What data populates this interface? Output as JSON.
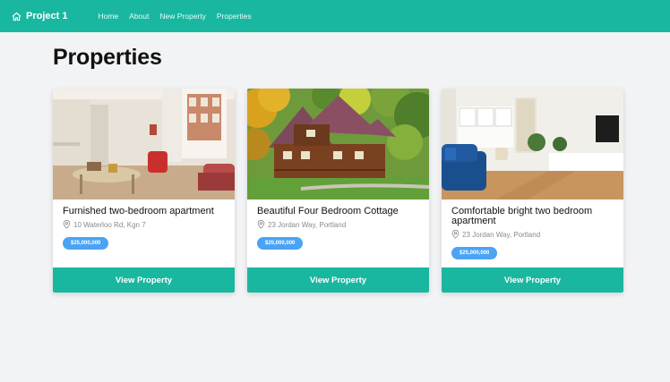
{
  "navbar": {
    "brand": "Project 1",
    "links": [
      "Home",
      "About",
      "New Property",
      "Properties"
    ]
  },
  "page": {
    "title": "Properties"
  },
  "properties": [
    {
      "title": "Furnished two-bedroom apartment",
      "location": "10 Waterloo Rd, Kgn 7",
      "price": "$25,000,000",
      "button": "View Property",
      "image_icon": "living-room-photo"
    },
    {
      "title": "Beautiful Four Bedroom Cottage",
      "location": "23 Jordan Way, Portland",
      "price": "$25,000,000",
      "button": "View Property",
      "image_icon": "log-cottage-photo"
    },
    {
      "title": "Comfortable bright two bedroom apartment",
      "location": "23 Jordan Way, Portland",
      "price": "$25,000,000",
      "button": "View Property",
      "image_icon": "bright-living-room-photo"
    }
  ],
  "colors": {
    "accent": "#1ab7a0",
    "badge": "#4aa3f4",
    "background": "#f2f3f5"
  }
}
